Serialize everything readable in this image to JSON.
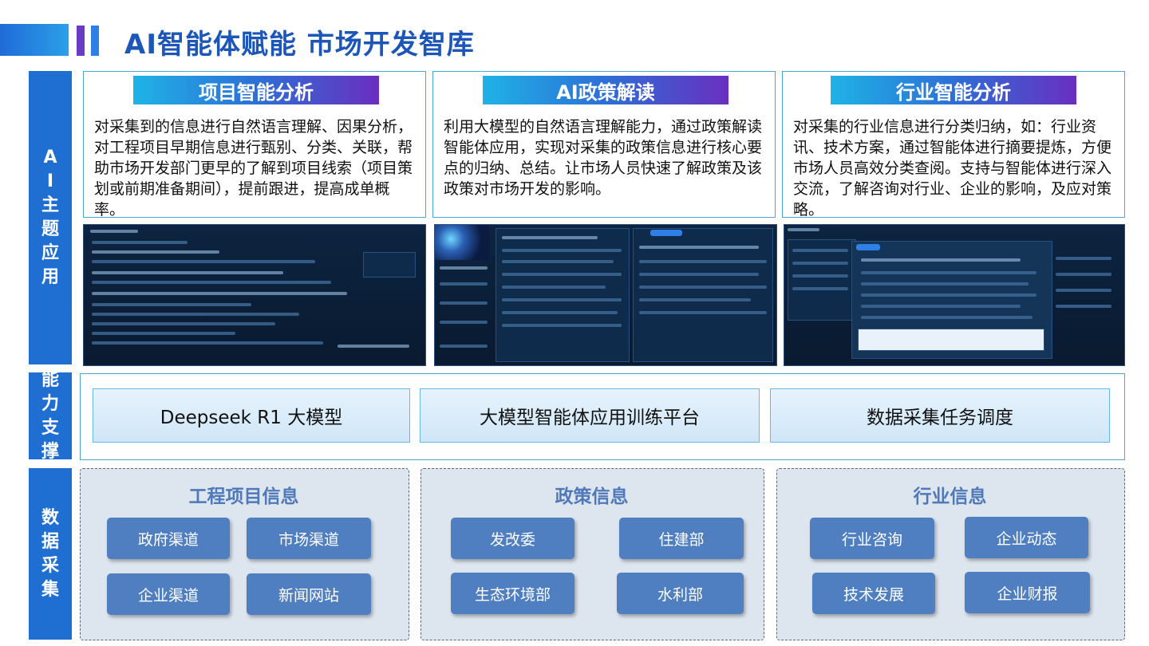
{
  "page": {
    "title": "AI智能体赋能 市场开发智库"
  },
  "side_labels": {
    "ai_topics": "AI主题应用",
    "capability": "能力支撑",
    "data_collection": "数据采集"
  },
  "applications": [
    {
      "title": "项目智能分析",
      "description": "对采集到的信息进行自然语言理解、因果分析，对工程项目早期信息进行甄别、分类、关联，帮助市场开发部门更早的了解到项目线索（项目策划或前期准备期间），提前跟进，提高成单概率。"
    },
    {
      "title": "AI政策解读",
      "description": "利用大模型的自然语言理解能力，通过政策解读智能体应用，实现对采集的政策信息进行核心要点的归纳、总结。让市场人员快速了解政策及该政策对市场开发的影响。"
    },
    {
      "title": "行业智能分析",
      "description": "对采集的行业信息进行分类归纳，如：行业资讯、技术方案，通过智能体进行摘要提炼，方便市场人员高效分类查阅。支持与智能体进行深入交流，了解咨询对行业、企业的影响，及应对策略。"
    }
  ],
  "capabilities": [
    "Deepseek R1 大模型",
    "大模型智能体应用训练平台",
    "数据采集任务调度"
  ],
  "data_groups": [
    {
      "title": "工程项目信息",
      "items": [
        "政府渠道",
        "市场渠道",
        "企业渠道",
        "新闻网站"
      ]
    },
    {
      "title": "政策信息",
      "items": [
        "发改委",
        "住建部",
        "生态环境部",
        "水利部"
      ]
    },
    {
      "title": "行业信息",
      "items": [
        "行业咨询",
        "企业动态",
        "技术发展",
        "企业财报"
      ]
    }
  ]
}
